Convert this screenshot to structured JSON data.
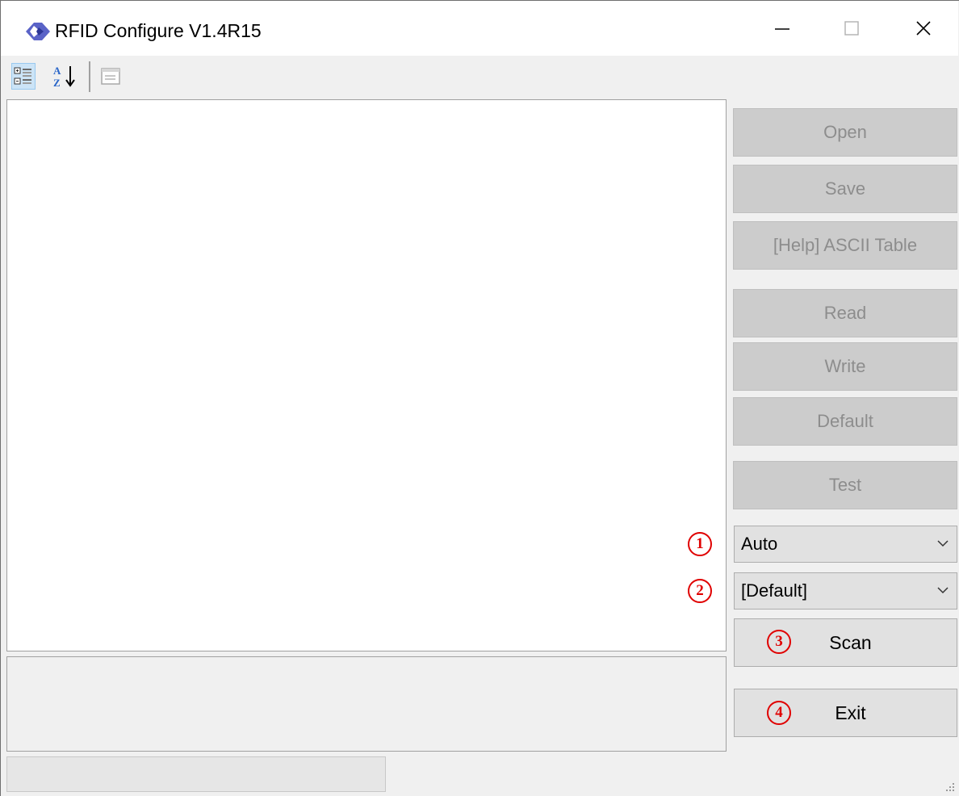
{
  "window": {
    "title": "RFID Configure V1.4R15"
  },
  "toolbar": {
    "buttons": [
      {
        "name": "categorized-icon",
        "active": true
      },
      {
        "name": "alphabetical-sort-icon",
        "active": false
      },
      {
        "name": "property-pages-icon",
        "active": false
      }
    ]
  },
  "buttons": {
    "open": "Open",
    "save": "Save",
    "help": "[Help] ASCII Table",
    "read": "Read",
    "write": "Write",
    "default": "Default",
    "test": "Test",
    "scan": "Scan",
    "exit": "Exit"
  },
  "selects": {
    "port": {
      "value": "Auto"
    },
    "device": {
      "value": "[Default]"
    }
  },
  "markers": [
    "1",
    "2",
    "3",
    "4"
  ],
  "colors": {
    "marker_red": "#e00000",
    "disabled_button": "#cccccc",
    "disabled_text": "#8d8d8d",
    "active_toolbar": "#cce4f7"
  }
}
